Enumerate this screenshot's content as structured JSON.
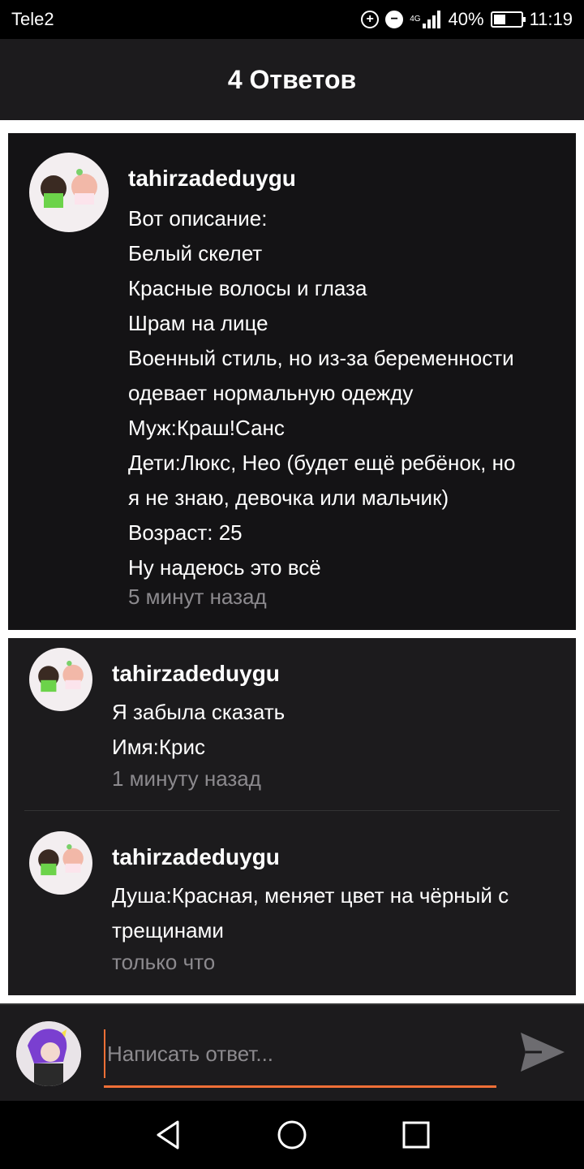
{
  "status_bar": {
    "carrier": "Tele2",
    "network": "4G",
    "battery": "40%",
    "time": "11:19"
  },
  "header": {
    "title": "4 Ответов"
  },
  "post": {
    "author": "tahirzadeduygu",
    "lines": [
      "Вот описание:",
      "Белый скелет",
      "Красные волосы и глаза",
      "Шрам на лице",
      "Военный стиль, но из-за беременности",
      "одевает нормальную одежду",
      "Муж:Краш!Санс",
      "Дети:Люкс, Нео (будет ещё ребёнок, но",
      "я не знаю, девочка или мальчик)",
      "Возраст: 25",
      "Ну надеюсь это всё"
    ],
    "time": "5 минут назад"
  },
  "replies": [
    {
      "author": "tahirzadeduygu",
      "lines": [
        "Я забыла сказать",
        "Имя:Крис"
      ],
      "time": "1 минуту назад"
    },
    {
      "author": "tahirzadeduygu",
      "lines": [
        "Душа:Красная, меняет цвет на чёрный с",
        "трещинами"
      ],
      "time": "только что"
    }
  ],
  "composer": {
    "placeholder": "Написать ответ..."
  },
  "colors": {
    "accent": "#ef6f37",
    "background": "#1c1b1d",
    "muted": "#8c8a8e"
  },
  "icons": [
    "alarm-icon",
    "dnd-icon",
    "signal-icon",
    "battery-icon",
    "send-icon",
    "back-icon",
    "home-icon",
    "recents-icon"
  ]
}
